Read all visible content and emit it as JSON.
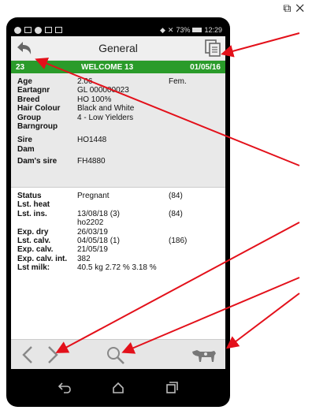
{
  "status_bar": {
    "signal_text": "✕",
    "battery": "73%",
    "time": "12:29"
  },
  "header": {
    "title": "General"
  },
  "summary_bar": {
    "id": "23",
    "name": "WELCOME 13",
    "date": "01/05/16"
  },
  "details": [
    {
      "label": "Age",
      "value": "2.06",
      "extra": "Fem."
    },
    {
      "label": "Eartagnr",
      "value": "GL 000000023",
      "extra": ""
    },
    {
      "label": "Breed",
      "value": "HO 100%",
      "extra": ""
    },
    {
      "label": "Hair Colour",
      "value": "Black and White",
      "extra": ""
    },
    {
      "label": "Group",
      "value": "4 - Low Yielders",
      "extra": ""
    },
    {
      "label": "Barngroup",
      "value": "",
      "extra": ""
    },
    {
      "label": "Sire",
      "value": "HO1448",
      "extra": ""
    },
    {
      "label": "Dam",
      "value": "",
      "extra": ""
    },
    {
      "label": "Dam's sire",
      "value": "FH4880",
      "extra": ""
    }
  ],
  "status": [
    {
      "label": "Status",
      "value": "Pregnant",
      "extra": "(84)"
    },
    {
      "label": "Lst. heat",
      "value": "",
      "extra": ""
    },
    {
      "label": "Lst. ins.",
      "value": "13/08/18 (3)",
      "extra": "(84)"
    },
    {
      "label": "",
      "value": "ho2202",
      "extra": ""
    },
    {
      "label": "Exp. dry",
      "value": "26/03/19",
      "extra": ""
    },
    {
      "label": "Lst. calv.",
      "value": "04/05/18 (1)",
      "extra": "(186)"
    },
    {
      "label": "Exp. calv.",
      "value": "21/05/19",
      "extra": ""
    },
    {
      "label": "Exp. calv. int.",
      "value": "382",
      "extra": ""
    },
    {
      "label": "Lst milk:",
      "value": "40.5 kg 2.72 %  3.18 %",
      "extra": ""
    }
  ],
  "colors": {
    "accent_green": "#2a9b2a",
    "annotation_red": "#e3101a"
  },
  "icons": {
    "corner": [
      "resize-icon",
      "close-icon"
    ],
    "header": [
      "back-arrow-icon",
      "copy-document-icon"
    ],
    "bottom": [
      "chevron-left-icon",
      "chevron-right-icon",
      "search-icon",
      "cow-icon"
    ],
    "system": [
      "system-back-icon",
      "home-icon",
      "recents-icon"
    ]
  }
}
